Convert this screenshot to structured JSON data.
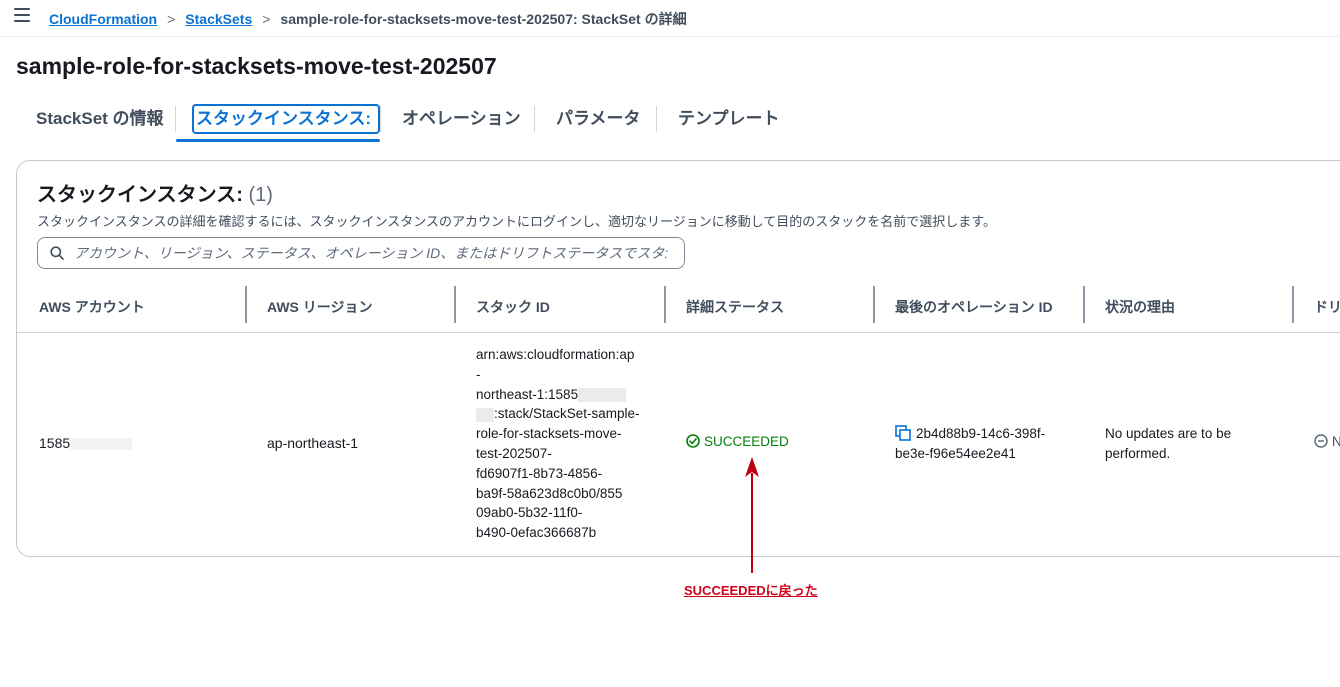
{
  "breadcrumb": {
    "items": [
      "CloudFormation",
      "StackSets"
    ],
    "current": "sample-role-for-stacksets-move-test-202507: StackSet の詳細"
  },
  "page": {
    "title": "sample-role-for-stacksets-move-test-202507"
  },
  "tabs": [
    {
      "label": "StackSet の情報",
      "active": false
    },
    {
      "label": "スタックインスタンス:",
      "active": true
    },
    {
      "label": "オペレーション",
      "active": false
    },
    {
      "label": "パラメータ",
      "active": false
    },
    {
      "label": "テンプレート",
      "active": false
    }
  ],
  "panel": {
    "title": "スタックインスタンス:",
    "count": "(1)",
    "description": "スタックインスタンスの詳細を確認するには、スタックインスタンスのアカウントにログインし、適切なリージョンに移動して目的のスタックを名前で選択します。",
    "search_placeholder": "アカウント、リージョン、ステータス、オペレーション ID、またはドリフトステータスでスタ:"
  },
  "table": {
    "columns": [
      "AWS アカウント",
      "AWS リージョン",
      "スタック ID",
      "詳細ステータス",
      "最後のオペレーション ID",
      "状況の理由",
      "ドリ"
    ],
    "row": {
      "account": "1585",
      "region": "ap-northeast-1",
      "stack_id_lines": [
        "arn:aws:cloudformation:ap",
        "-",
        "northeast-1:1585",
        ":stack/StackSet-sample-",
        "role-for-stacksets-move-",
        "test-202507-",
        "fd6907f1-8b73-4856-",
        "ba9f-58a623d8c0b0/855",
        "09ab0-5b32-11f0-",
        "b490-0efac366687b"
      ],
      "status": "SUCCEEDED",
      "operation_id": "2b4d88b9-14c6-398f-be3e-f96e54ee2e41",
      "reason": "No updates are to be performed.",
      "drift": "N"
    }
  },
  "annotation": {
    "text": "SUCCEEDEDに戻った",
    "color": "#d0021b"
  },
  "colors": {
    "accent": "#0972d3",
    "success": "#037f0c",
    "text": "#16191f"
  }
}
